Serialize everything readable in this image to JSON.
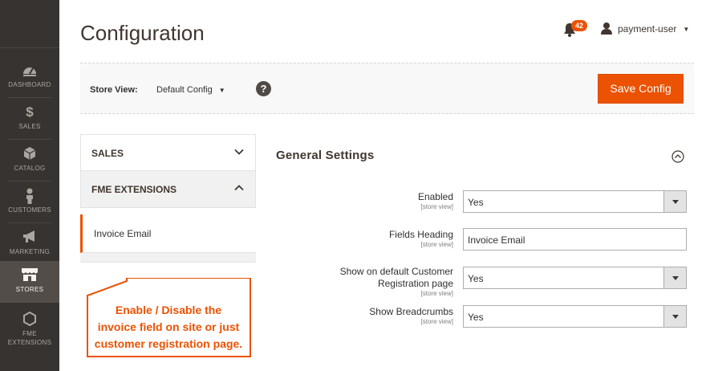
{
  "sidebar": {
    "items": [
      {
        "label": "DASHBOARD",
        "icon": "dashboard-icon"
      },
      {
        "label": "SALES",
        "icon": "dollar-icon"
      },
      {
        "label": "CATALOG",
        "icon": "box-icon"
      },
      {
        "label": "CUSTOMERS",
        "icon": "person-icon"
      },
      {
        "label": "MARKETING",
        "icon": "megaphone-icon"
      },
      {
        "label": "STORES",
        "icon": "store-icon"
      },
      {
        "label": "FME\nEXTENSIONS",
        "icon": "hexagon-icon"
      }
    ],
    "active": "STORES"
  },
  "header": {
    "title": "Configuration",
    "notifications_count": "42",
    "user_name": "payment-user"
  },
  "store_bar": {
    "label": "Store View:",
    "selected": "Default Config",
    "help": "?",
    "save_label": "Save Config"
  },
  "tabs": {
    "sales": "SALES",
    "fme": "FME EXTENSIONS",
    "item": "Invoice Email"
  },
  "callout": {
    "line1": "Enable / Disable the",
    "line2": "invoice field on site or just",
    "line3": "customer registration page."
  },
  "section": {
    "title": "General Settings",
    "fields": [
      {
        "label": "Enabled",
        "scope": "[store view]",
        "value": "Yes"
      },
      {
        "label": "Fields Heading",
        "scope": "[store view]",
        "value": "Invoice Email"
      },
      {
        "label_line1": "Show on default Customer",
        "label_line2": "Registration page",
        "scope": "[store view]",
        "value": "Yes"
      },
      {
        "label": "Show Breadcrumbs",
        "scope": "[store view]",
        "value": "Yes"
      }
    ]
  },
  "colors": {
    "accent": "#eb5202",
    "sidebar": "#373330",
    "sidebar_active": "#524d49"
  }
}
